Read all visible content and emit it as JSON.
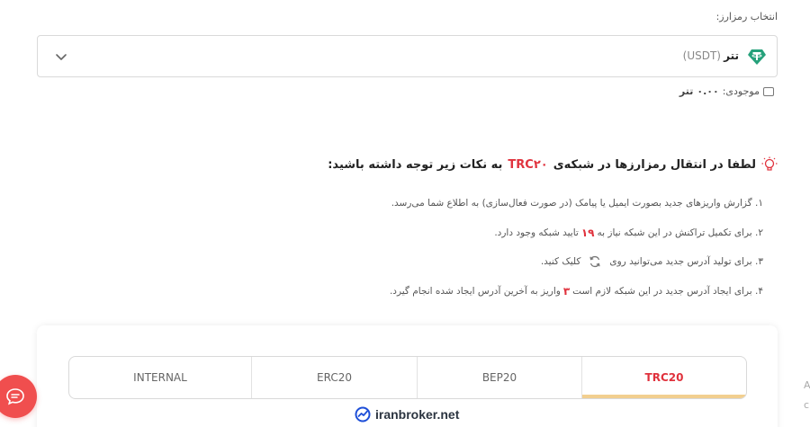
{
  "select": {
    "label": "انتخاب رمزارز:",
    "coin_name": "تتر",
    "coin_code": "(USDT)"
  },
  "balance": {
    "label": "موجودی:",
    "value": "۰.۰۰",
    "unit": "تتر"
  },
  "notice": {
    "title_before": "لطفا در انتقال رمزارزها در شبکه‌ی",
    "network": "TRC۲۰",
    "title_after": "به نکات زیر توجه داشته باشید:",
    "items": {
      "i1": "۱. گزارش واریزهای جدید بصورت ایمیل یا پیامک (در صورت فعال‌سازی) به اطلاع شما می‌رسد.",
      "i2_before": "۲. برای تکمیل تراکنش در این شبکه نیاز به",
      "i2_num": "۱۹",
      "i2_after": "تایید شبکه وجود دارد.",
      "i3_before": "۳. برای تولید آدرس جدید می‌توانید روی",
      "i3_after": "کلیک کنید.",
      "i4_before": "۴. برای ایجاد آدرس جدید در این شبکه لازم است",
      "i4_num": "۳",
      "i4_after": "واریز به آخرین آدرس ایجاد شده انجام گیرد."
    }
  },
  "tabs": {
    "internal": "INTERNAL",
    "erc20": "ERC20",
    "bep20": "BEP20",
    "trc20": "TRC20"
  },
  "brand": {
    "text": "iranbroker.net"
  },
  "edge": {
    "char1": "A",
    "char2": "c"
  },
  "colors": {
    "accent_red": "#e0323d",
    "tab_underline": "#f2cf8f",
    "tether_green": "#26a17b",
    "chat_button": "#f04e4e"
  }
}
